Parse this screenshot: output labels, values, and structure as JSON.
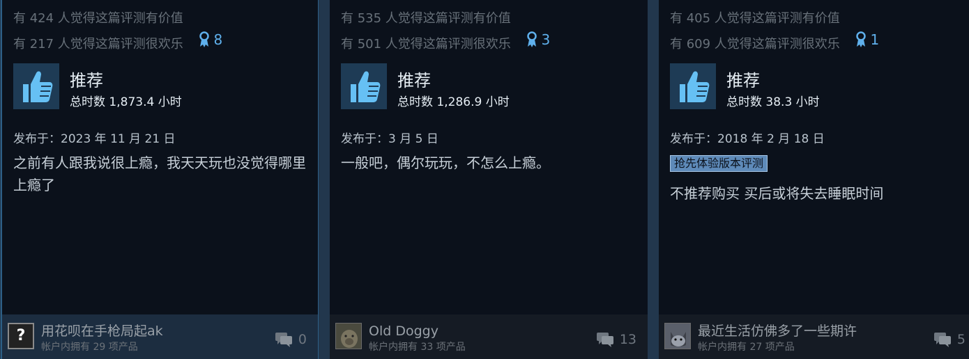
{
  "reviews": [
    {
      "helpful_text": "有 424 人觉得这篇评测有价值",
      "funny_text": "有 217 人觉得这篇评测很欢乐",
      "awards_count": "8",
      "recommendation": "推荐",
      "hours": "总时数 1,873.4 小时",
      "posted": "发布于：2023 年 11 月 21 日",
      "text": "之前有人跟我说很上瘾，我天天玩也没觉得哪里上瘾了",
      "author": "用花呗在手枪局起ak",
      "owned": "帐户内拥有 29 项产品",
      "comments_count": "0",
      "avatar": "question-mark",
      "avatar_symbol": "?"
    },
    {
      "helpful_text": "有 535 人觉得这篇评测有价值",
      "funny_text": "有 501 人觉得这篇评测很欢乐",
      "awards_count": "3",
      "recommendation": "推荐",
      "hours": "总时数 1,286.9 小时",
      "posted": "发布于：3 月 5 日",
      "text": "一般吧，偶尔玩玩，不怎么上瘾。",
      "author": "Old Doggy",
      "owned": "帐户内拥有 33 项产品",
      "comments_count": "13",
      "avatar": "dog-photo"
    },
    {
      "helpful_text": "有 405 人觉得这篇评测有价值",
      "funny_text": "有 609 人觉得这篇评测很欢乐",
      "awards_count": "1",
      "recommendation": "推荐",
      "hours": "总时数 38.3 小时",
      "posted": "发布于：2018 年 2 月 18 日",
      "early_access_badge": "抢先体验版本评测",
      "text": "不推荐购买 买后或将失去睡眠时间",
      "author": "最近生活仿佛多了一些期许",
      "owned": "帐户内拥有 27 项产品",
      "comments_count": "5",
      "avatar": "cat-photo"
    }
  ],
  "icons": {
    "thumbs_up": "thumbs-up-icon",
    "award": "award-ribbon-icon",
    "comment": "comment-bubble-icon"
  },
  "colors": {
    "card_bg": "#0b111b",
    "accent_blue": "#5fb0ec",
    "thumb_bg": "#1e3b55",
    "selected_border": "#2d5f86"
  }
}
